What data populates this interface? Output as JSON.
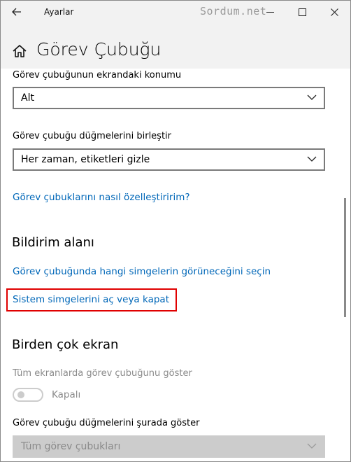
{
  "window": {
    "app_title": "Ayarlar",
    "watermark": "Sordum.net"
  },
  "header": {
    "title": "Görev Çubuğu"
  },
  "taskbar_location": {
    "label": "Görev çubuğunun ekrandaki konumu",
    "value": "Alt"
  },
  "combine_buttons": {
    "label": "Görev çubuğu düğmelerini birleştir",
    "value": "Her zaman, etiketleri gizle"
  },
  "customize_link": "Görev çubuklarını nasıl özelleştiririm?",
  "notification_area": {
    "heading": "Bildirim alanı",
    "select_icons_link": "Görev çubuğunda hangi simgelerin görüneceğini seçin",
    "system_icons_link": "Sistem simgelerini aç veya kapat"
  },
  "multiple_displays": {
    "heading": "Birden çok ekran",
    "show_taskbar_label": "Tüm ekranlarda görev çubuğunu göster",
    "toggle_state": "Kapalı",
    "show_buttons_label": "Görev çubuğu düğmelerini şurada göster",
    "show_buttons_value": "Tüm görev çubukları"
  },
  "colors": {
    "link": "#0067b8",
    "highlight": "#e00000",
    "disabled": "#8a8a8a"
  }
}
